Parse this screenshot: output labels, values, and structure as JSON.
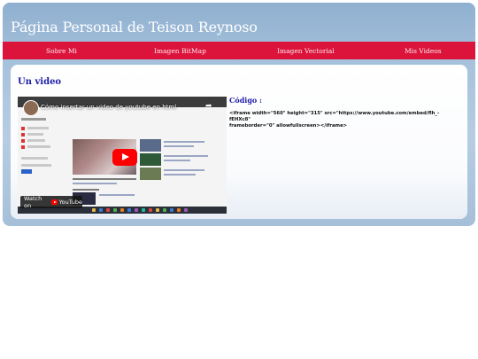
{
  "header": {
    "title": "Página Personal de Teison Reynoso"
  },
  "nav": {
    "items": [
      {
        "label": "Sobre Mi"
      },
      {
        "label": "Imagen BitMap"
      },
      {
        "label": "Imagen Vectorial"
      },
      {
        "label": "Mis Videos"
      }
    ]
  },
  "main": {
    "heading": "Un video",
    "video": {
      "title": "Cómo insertar un video de youtube en html",
      "watch_label": "Watch on",
      "platform": "YouTube"
    },
    "code_label": "Código :",
    "code_line1": "<iframe width=\"560\" height=\"315\" src=\"https://www.youtube.com/embed/flh_-fEHXc8\"",
    "code_line2": "frameborder=\"0\" allowfullscreen></iframe>"
  },
  "colors": {
    "nav_bg": "#dc143c",
    "heading": "#1c1ca8",
    "page_bg": "#a9c3dc"
  }
}
